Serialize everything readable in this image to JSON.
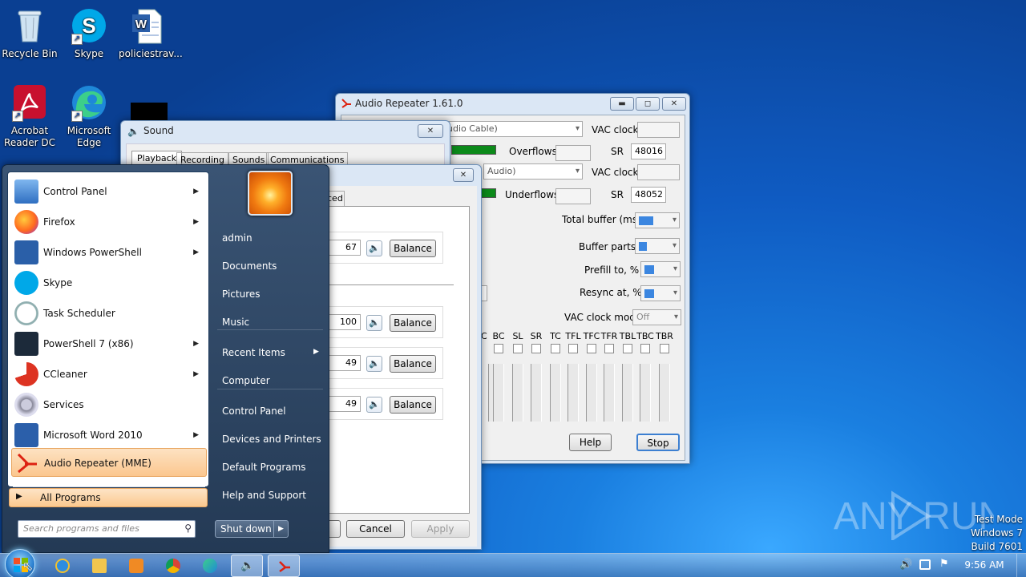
{
  "desktop": {
    "icons": [
      {
        "label": "Recycle Bin"
      },
      {
        "label": "Skype"
      },
      {
        "label": "policiestrav..."
      },
      {
        "label": "Acrobat\nReader DC"
      },
      {
        "label": "Microsoft\nEdge"
      }
    ],
    "watermark": {
      "brand": "ANY RUN",
      "line1": "Test Mode",
      "line2": "Windows 7",
      "line3": "Build 7601"
    }
  },
  "audio_repeater": {
    "title": "Audio Repeater 1.61.0",
    "input_device": "udio Cable)",
    "output_device": "Audio)",
    "vac_clock_label": "VAC clock",
    "overflows_label": "Overflows",
    "underflows_label": "Underflows",
    "sr_label": "SR",
    "sr_in": "48016",
    "sr_out": "48052",
    "total_buffer_label": "Total buffer (ms)",
    "buffer_parts_label": "Buffer parts",
    "prefill_label": "Prefill to, %",
    "resync_label": "Resync at, %",
    "vac_clock_mode_label": "VAC clock mode",
    "vac_clock_mode_value": "Off",
    "channels": [
      "C",
      "BC",
      "SL",
      "SR",
      "TC",
      "TFL",
      "TFC",
      "TFR",
      "TBL",
      "TBC",
      "TBR"
    ],
    "help_button": "Help",
    "stop_button": "Stop",
    "vu_in_color": "#0c8a1a",
    "vu_out_color": "#0c8a1a"
  },
  "sound": {
    "title": "Sound",
    "tabs": [
      "Playback",
      "Recording",
      "Sounds",
      "Communications"
    ]
  },
  "properties": {
    "tab_partial": "ced",
    "levels": [
      {
        "value": "67",
        "button": "Balance"
      },
      {
        "value": "100",
        "button": "Balance"
      },
      {
        "value": "49",
        "button": "Balance"
      },
      {
        "value": "49",
        "button": "Balance"
      }
    ],
    "cancel": "Cancel",
    "apply": "Apply"
  },
  "start_menu": {
    "programs": [
      {
        "label": "Control Panel",
        "icon": "control-panel-icon",
        "arrow": true
      },
      {
        "label": "Firefox",
        "icon": "firefox-icon",
        "arrow": true
      },
      {
        "label": "Windows PowerShell",
        "icon": "powershell-icon",
        "arrow": true
      },
      {
        "label": "Skype",
        "icon": "skype-icon",
        "arrow": false
      },
      {
        "label": "Task Scheduler",
        "icon": "clock-icon",
        "arrow": false
      },
      {
        "label": "PowerShell 7 (x86)",
        "icon": "powershell7-icon",
        "arrow": true
      },
      {
        "label": "CCleaner",
        "icon": "ccleaner-icon",
        "arrow": true
      },
      {
        "label": "Services",
        "icon": "gears-icon",
        "arrow": false
      },
      {
        "label": "Microsoft Word 2010",
        "icon": "word-icon",
        "arrow": true
      },
      {
        "label": "Audio Repeater (MME)",
        "icon": "audio-repeater-icon",
        "arrow": false
      }
    ],
    "all_programs": "All Programs",
    "search_placeholder": "Search programs and files",
    "right_items": [
      "admin",
      "Documents",
      "Pictures",
      "Music",
      "Recent Items",
      "Computer",
      "Control Panel",
      "Devices and Printers",
      "Default Programs",
      "Help and Support"
    ],
    "shutdown": "Shut down"
  },
  "taskbar": {
    "time": "9:56 AM"
  }
}
